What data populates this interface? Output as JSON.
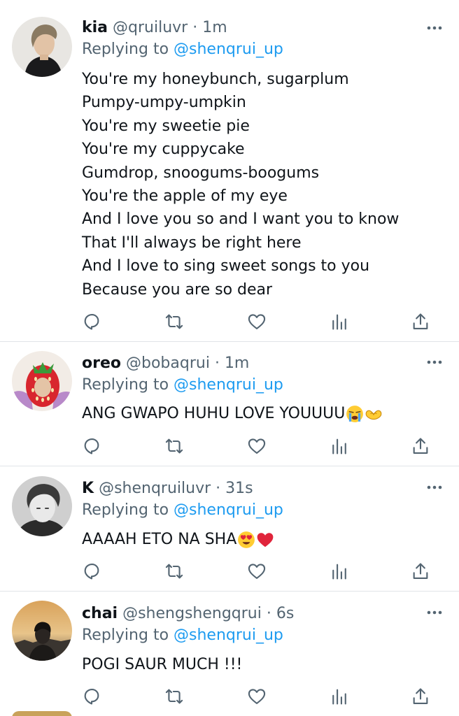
{
  "tweets": [
    {
      "name": "kia",
      "handle": "@qruiluvr",
      "separator": "·",
      "time": "1m",
      "replying_label": "Replying to",
      "replying_to": "@shenqrui_up",
      "lines": [
        "You're my honeybunch, sugarplum",
        "Pumpy-umpy-umpkin",
        "You're my sweetie pie",
        "You're my cuppycake",
        "Gumdrop, snoogums-boogums",
        "You're the apple of my eye",
        "And I love you so and I want you to know",
        "That I'll always be right here",
        "And I love to sing sweet songs to you",
        "Because you are so dear"
      ],
      "avatar": "person-profile-dark-hair"
    },
    {
      "name": "oreo",
      "handle": "@bobaqrui",
      "separator": "·",
      "time": "1m",
      "replying_label": "Replying to",
      "replying_to": "@shenqrui_up",
      "text": "ANG GWAPO HUHU LOVE YOUUUU",
      "emojis": [
        "loudly-crying-face",
        "heart-hands"
      ],
      "avatar": "strawberry-hat-person"
    },
    {
      "name": "K",
      "handle": "@shenqruiluvr",
      "separator": "·",
      "time": "31s",
      "replying_label": "Replying to",
      "replying_to": "@shenqrui_up",
      "text": "AAAAH ETO NA SHA",
      "emojis": [
        "heart-eyes-face",
        "red-heart"
      ],
      "avatar": "monochrome-portrait"
    },
    {
      "name": "chai",
      "handle": "@shengshengqrui",
      "separator": "·",
      "time": "6s",
      "replying_label": "Replying to",
      "replying_to": "@shenqrui_up",
      "text": "POGI SAUR MUCH !!!",
      "avatar": "sunset-silhouette"
    }
  ],
  "actions": [
    "reply-icon",
    "retweet-icon",
    "like-icon",
    "analytics-icon",
    "share-icon"
  ],
  "colors": {
    "text": "#0f1419",
    "secondary": "#536471",
    "link": "#1d9bf0",
    "divider": "#e1e4e8",
    "heart_red": "#e0243b"
  }
}
